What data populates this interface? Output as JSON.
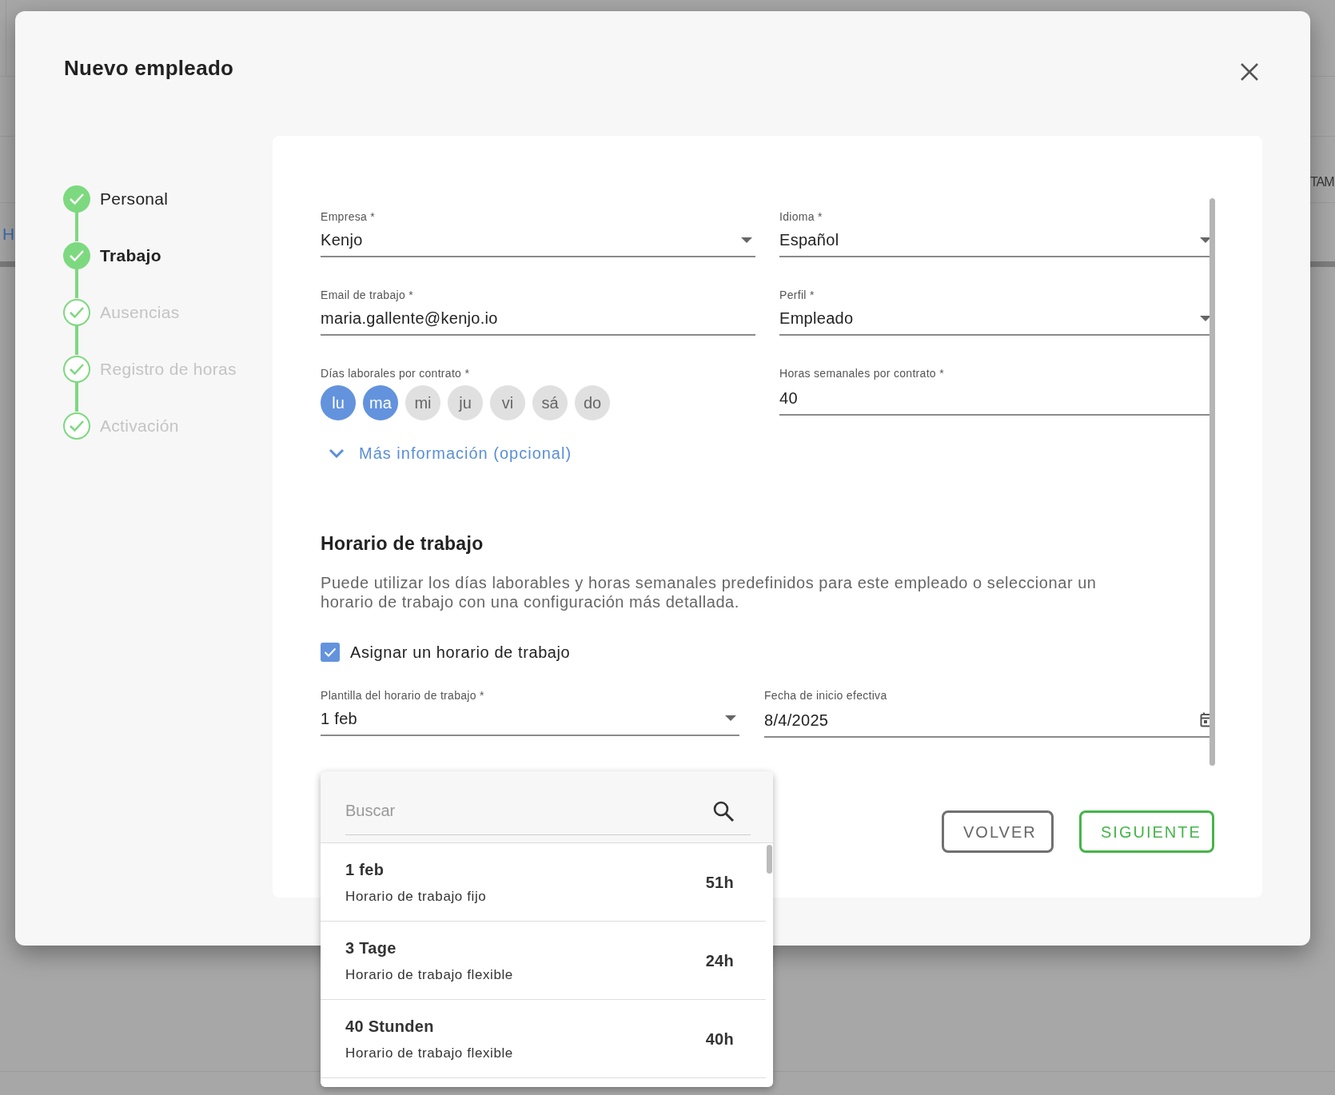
{
  "background": {
    "left_text": "H",
    "right_text": "TAM"
  },
  "dialog": {
    "title": "Nuevo empleado"
  },
  "steps": [
    {
      "label": "Personal",
      "completed": true,
      "selected": false
    },
    {
      "label": "Trabajo",
      "completed": true,
      "selected": true
    },
    {
      "label": "Ausencias",
      "completed": false,
      "selected": false
    },
    {
      "label": "Registro de horas",
      "completed": false,
      "selected": false
    },
    {
      "label": "Activación",
      "completed": false,
      "selected": false
    }
  ],
  "fields": [
    {
      "kind": "select",
      "label": "Empresa *",
      "value": "Kenjo"
    },
    {
      "kind": "select",
      "label": "Idioma *",
      "value": "Español"
    },
    {
      "kind": "text",
      "label": "Email de trabajo *",
      "value": "maria.gallente@kenjo.io"
    },
    {
      "kind": "select",
      "label": "Perfil *",
      "value": "Empleado"
    },
    {
      "kind": "days",
      "label": "Días laborales por contrato *",
      "days": [
        {
          "label": "lu",
          "selected": true
        },
        {
          "label": "ma",
          "selected": true
        },
        {
          "label": "mi",
          "selected": false
        },
        {
          "label": "ju",
          "selected": false
        },
        {
          "label": "vi",
          "selected": false
        },
        {
          "label": "sá",
          "selected": false
        },
        {
          "label": "do",
          "selected": false
        }
      ]
    },
    {
      "kind": "text",
      "label": "Horas semanales por contrato *",
      "value": "40"
    }
  ],
  "more_info": {
    "label": "Más información (opcional)",
    "expanded": false
  },
  "schedule": {
    "title": "Horario de trabajo",
    "description": "Puede utilizar los días laborables y horas semanales predefinidos para este empleado o seleccionar un horario de trabajo con una configuración más detallada.",
    "assign": {
      "label": "Asignar un horario de trabajo",
      "checked": true
    },
    "template": {
      "label": "Plantilla del horario de trabajo *",
      "value": "1 feb"
    },
    "start_date": {
      "label": "Fecha de inicio efectiva",
      "value": "8/4/2025"
    }
  },
  "dropdown": {
    "placeholder": "Buscar",
    "options": [
      {
        "name": "1 feb",
        "type": "Horario de trabajo fijo",
        "hours": "51h"
      },
      {
        "name": "3 Tage",
        "type": "Horario de trabajo flexible",
        "hours": "24h"
      },
      {
        "name": "40 Stunden",
        "type": "Horario de trabajo flexible",
        "hours": "40h"
      }
    ]
  },
  "buttons": [
    {
      "label": "VOLVER",
      "kind": "secondary"
    },
    {
      "label": "SIGUIENTE",
      "kind": "primary"
    }
  ]
}
